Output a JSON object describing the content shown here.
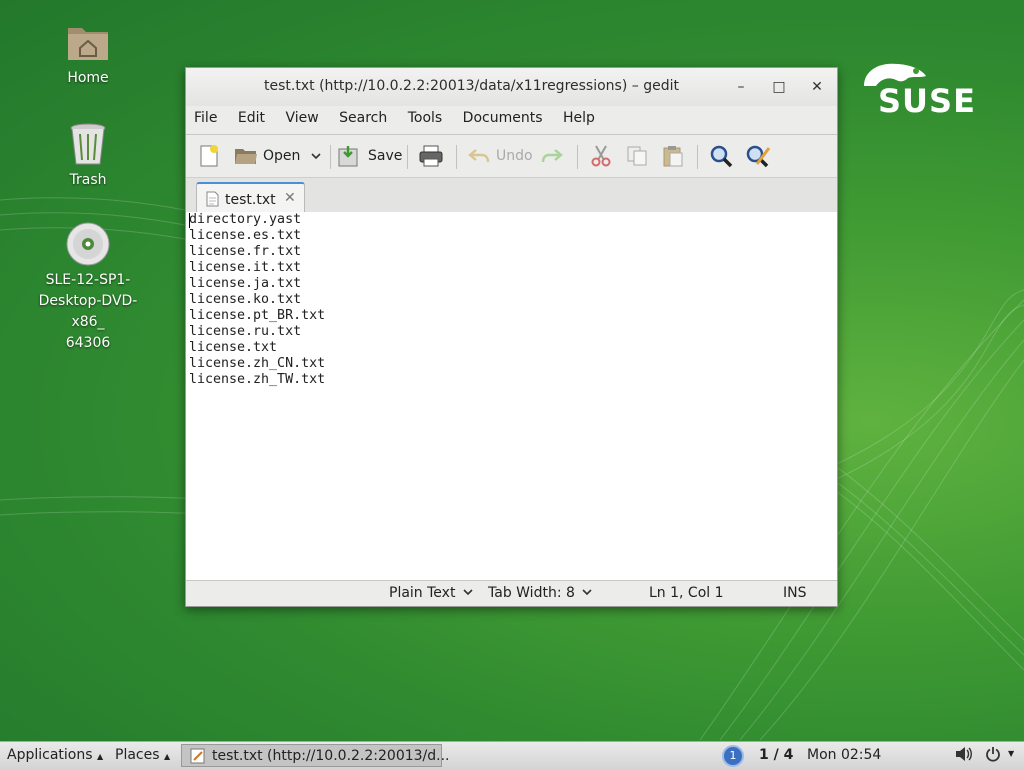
{
  "desktop": {
    "icons": [
      {
        "label": "Home"
      },
      {
        "label": "Trash"
      },
      {
        "label_lines": [
          "SLE-12-SP1-",
          "Desktop-DVD-x86_",
          "64306"
        ]
      }
    ],
    "logo_text": "SUSE"
  },
  "window": {
    "title": "test.txt (http://10.0.2.2:20013/data/x11regressions) – gedit",
    "controls": {
      "minimize": "–",
      "maximize": "□",
      "close": "✕"
    },
    "menu": [
      "File",
      "Edit",
      "View",
      "Search",
      "Tools",
      "Documents",
      "Help"
    ],
    "toolbar": {
      "open_label": "Open",
      "save_label": "Save",
      "undo_label": "Undo"
    },
    "tab": {
      "label": "test.txt",
      "close": "✕"
    },
    "editor_lines": [
      "directory.yast",
      "license.es.txt",
      "license.fr.txt",
      "license.it.txt",
      "license.ja.txt",
      "license.ko.txt",
      "license.pt_BR.txt",
      "license.ru.txt",
      "license.txt",
      "license.zh_CN.txt",
      "license.zh_TW.txt"
    ],
    "status": {
      "language": "Plain Text",
      "tab_width": "Tab Width: 8",
      "position": "Ln 1, Col 1",
      "mode": "INS"
    }
  },
  "taskbar": {
    "applications": "Applications",
    "places": "Places",
    "window_label": "test.txt (http://10.0.2.2:20013/d...",
    "workspace_badge": "1",
    "workspace": "1 / 4",
    "clock": "Mon 02:54"
  },
  "colors": {
    "desktop_green": "#3f9a33",
    "tab_accent": "#4a90d9"
  }
}
